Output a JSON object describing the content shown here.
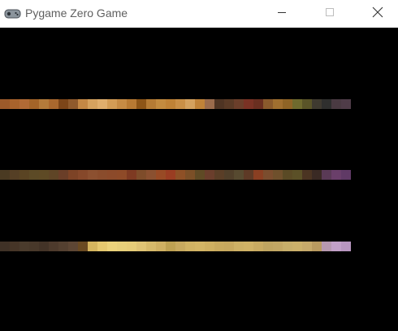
{
  "window": {
    "title": "Pygame Zero Game",
    "app_icon": "gamepad-icon",
    "controls": [
      "minimize-icon",
      "maximize-icon",
      "close-icon"
    ]
  },
  "canvas": {
    "background": "#000000",
    "strips": [
      {
        "name": "palette-strip-1",
        "colors": [
          "#9c5a2a",
          "#a8632c",
          "#b16a35",
          "#a36428",
          "#b37a3a",
          "#a9682e",
          "#7c4518",
          "#8f5a2c",
          "#c48845",
          "#d6a25e",
          "#e0ae6c",
          "#d39c55",
          "#c68b44",
          "#b87a33",
          "#8d5517",
          "#b57b34",
          "#c38b3f",
          "#bf8236",
          "#c98f46",
          "#d4a15e",
          "#c08238",
          "#9b6b4c",
          "#4f3423",
          "#5a3a26",
          "#6b3e2a",
          "#7a3224",
          "#6a2f20",
          "#8a5a2c",
          "#a06f2f",
          "#8f6426",
          "#6f6a2e",
          "#5a5428",
          "#3f3a30",
          "#2f2f2e",
          "#4a3a42",
          "#4f3c48"
        ]
      },
      {
        "name": "palette-strip-2",
        "colors": [
          "#4a3a22",
          "#553f25",
          "#5a4423",
          "#5c4a26",
          "#5e4a25",
          "#5f4526",
          "#6a3e28",
          "#7d4326",
          "#86482a",
          "#8c5030",
          "#8a4c2c",
          "#8c4a2a",
          "#8e4a28",
          "#7e3a22",
          "#7e4c2a",
          "#8a5030",
          "#984a25",
          "#9a3d22",
          "#8e5026",
          "#7b4f27",
          "#5f4a25",
          "#6a3e2c",
          "#5a3e27",
          "#503f2a",
          "#574a30",
          "#5e3a26",
          "#8a3f22",
          "#7b4d2e",
          "#6f502c",
          "#5a4a25",
          "#5b5027",
          "#4b3422",
          "#3a2a24",
          "#5a3a56",
          "#6a3f6a",
          "#603a66"
        ]
      },
      {
        "name": "palette-strip-3",
        "colors": [
          "#3f3126",
          "#463527",
          "#4a3b2c",
          "#48382a",
          "#433327",
          "#4d3a2c",
          "#544030",
          "#5d4634",
          "#6a4a22",
          "#d5b55e",
          "#e5c86f",
          "#ebd27b",
          "#e7cf7a",
          "#e6cc78",
          "#dfc374",
          "#d6b96a",
          "#cfb062",
          "#bea152",
          "#c7a95e",
          "#d0b263",
          "#d3b565",
          "#cfb061",
          "#c9aa5e",
          "#c7a85e",
          "#cdb065",
          "#d0b266",
          "#c9ab62",
          "#c0a561",
          "#c2a764",
          "#c7ae6a",
          "#cbb06a",
          "#c6a96a",
          "#b99a60",
          "#b798b0",
          "#c2a0c8",
          "#b896c0"
        ]
      }
    ]
  }
}
